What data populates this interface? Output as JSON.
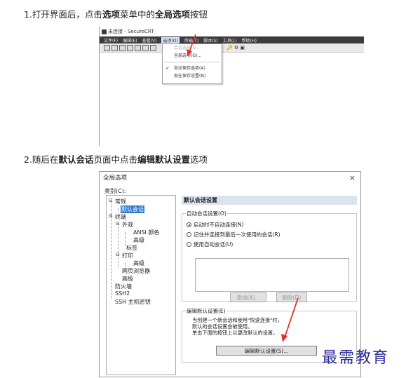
{
  "step1": {
    "prefix": "1.打开界面后，点击",
    "menu": "选项",
    "mid": "菜单中的",
    "item": "全局选项",
    "suffix": "按钮"
  },
  "window1": {
    "title": "未连接 - SecureCRT",
    "menus": [
      "文件(F)",
      "编辑(E)",
      "查看(V)",
      "选项(O)",
      "传输(T)",
      "脚本(S)",
      "工具(L)",
      "帮助(H)"
    ],
    "dropdown": [
      "会话选项(S)...",
      "全局选项(G)...",
      "自动保存选项(A)",
      "现在保存设置(N)"
    ]
  },
  "step2": {
    "prefix": "2.随后在",
    "page": "默认会话",
    "mid": "页面中点击",
    "button": "编辑默认设置",
    "suffix": "选项"
  },
  "dialog": {
    "title": "全局选项",
    "close": "×",
    "category_label": "类别(C):",
    "tree": [
      "常规",
      "默认会话",
      "终端",
      "外观",
      "ANSI 颜色",
      "高级",
      "标签",
      "打印",
      "高级",
      "网页浏览器",
      "高级",
      "防火墙",
      "SSH2",
      "SSH 主机密钥"
    ],
    "panel_title": "默认会话设置",
    "auto_group": "自动会话设置(O)",
    "radios": [
      "启动时不自动连接(N)",
      "记住并连接到最后一次使用的会话(R)",
      "使用自动会话(U)"
    ],
    "add_button": "添加(A)...",
    "delete_button": "删除(D)",
    "edit_group": "编辑默认设置(E)",
    "desc": [
      "当创建一个新会话和使用\"快速连接\"时，",
      "默认的会话设置会被使用。",
      "单击下面的按钮上以更改默认的设置。"
    ],
    "edit_button": "编辑默认设置(S)..."
  },
  "watermark": "最需教育",
  "colors": {
    "selected": "#2f7ad6",
    "arrow": "#e0322a",
    "panel_header": "#dbe3ee"
  }
}
